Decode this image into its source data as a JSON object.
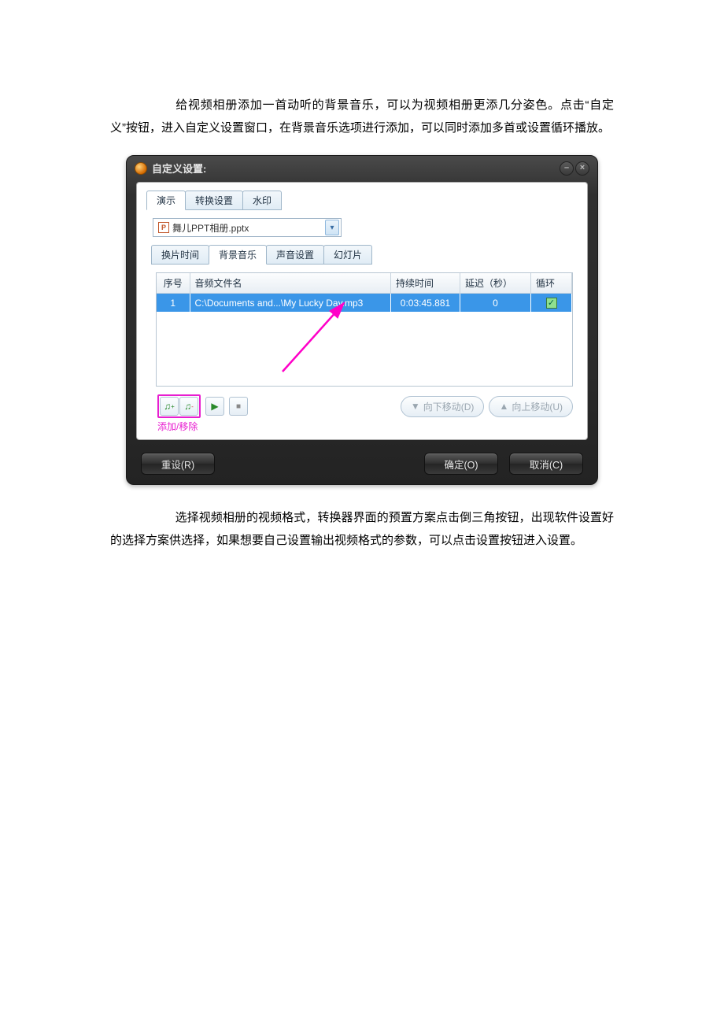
{
  "paragraphs": {
    "p1": "给视频相册添加一首动听的背景音乐，可以为视频相册更添几分姿色。点击“自定义”按钮，进入自定义设置窗口，在背景音乐选项进行添加，可以同时添加多首或设置循环播放。",
    "p2": "选择视频相册的视频格式，转换器界面的预置方案点击倒三角按钮，出现软件设置好的选择方案供选择，如果想要自己设置输出视频格式的参数，可以点击设置按钮进入设置。"
  },
  "dialog": {
    "title": "自定义设置:",
    "outerTabs": {
      "t0": "演示",
      "t1": "转换设置",
      "t2": "水印"
    },
    "file": "舞儿PPT相册.pptx",
    "innerTabs": {
      "i0": "换片时间",
      "i1": "背景音乐",
      "i2": "声音设置",
      "i3": "幻灯片"
    },
    "columns": {
      "c0": "序号",
      "c1": "音频文件名",
      "c2": "持续时间",
      "c3": "延迟（秒）",
      "c4": "循环"
    },
    "row": {
      "idx": "1",
      "file": "C:\\Documents and...\\My Lucky Day.mp3",
      "dur": "0:03:45.881",
      "delay": "0"
    },
    "controls": {
      "moveDown": "向下移动(D)",
      "moveUp": "向上移动(U)",
      "addRemove": "添加/移除"
    },
    "buttons": {
      "reset": "重设(R)",
      "ok": "确定(O)",
      "cancel": "取消(C)"
    }
  }
}
